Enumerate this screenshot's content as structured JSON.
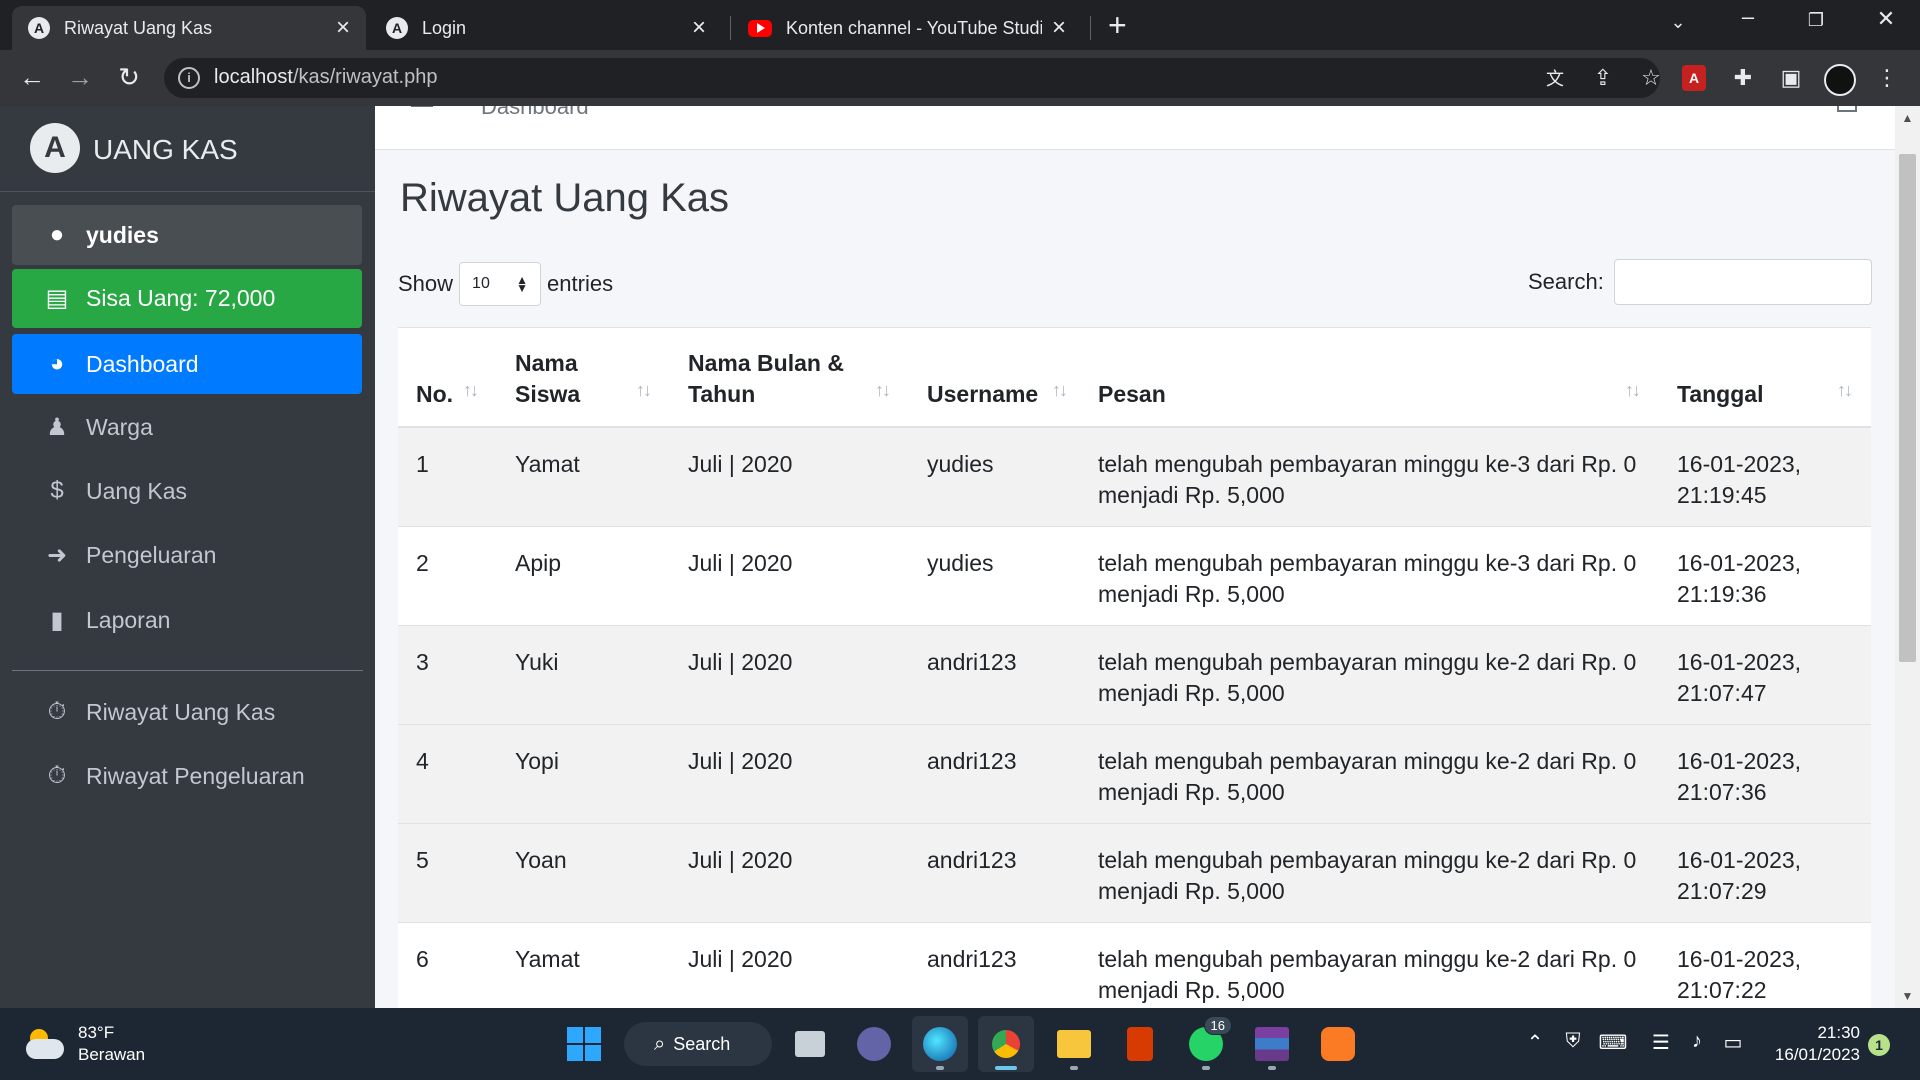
{
  "browser": {
    "tabs": [
      {
        "title": "Riwayat Uang Kas",
        "favicon": "uangkas-logo-icon",
        "active": true
      },
      {
        "title": "Login",
        "favicon": "uangkas-logo-icon",
        "active": false
      },
      {
        "title": "Konten channel - YouTube Studio",
        "favicon": "youtube-icon",
        "active": false
      }
    ],
    "url_host": "localhost",
    "url_path": "/kas/riwayat.php"
  },
  "sidebar": {
    "brand": "UANG KAS",
    "brand_logo_letter": "A",
    "user": "yudies",
    "balance": "Sisa Uang: 72,000",
    "items": [
      {
        "label": "Dashboard",
        "icon": "tachometer-icon"
      },
      {
        "label": "Warga",
        "icon": "user-icon"
      },
      {
        "label": "Uang Kas",
        "icon": "dollar-icon"
      },
      {
        "label": "Pengeluaran",
        "icon": "sign-out-icon"
      },
      {
        "label": "Laporan",
        "icon": "file-icon"
      },
      {
        "label": "Riwayat Uang Kas",
        "icon": "stopwatch-icon"
      },
      {
        "label": "Riwayat Pengeluaran",
        "icon": "stopwatch-icon"
      }
    ]
  },
  "topnav": {
    "breadcrumb": "Dashboard"
  },
  "main": {
    "title": "Riwayat Uang Kas",
    "show_label": "Show",
    "entries_value": "10",
    "entries_label": "entries",
    "search_label": "Search:",
    "search_value": ""
  },
  "table": {
    "columns": [
      "No.",
      "Nama Siswa",
      "Nama Bulan & Tahun",
      "Username",
      "Pesan",
      "Tanggal"
    ],
    "rows": [
      {
        "no": "1",
        "nama": "Yamat",
        "bulan": "Juli | 2020",
        "username": "yudies",
        "pesan": "telah mengubah pembayaran minggu ke-3 dari Rp. 0 menjadi Rp. 5,000",
        "tanggal": "16-01-2023, 21:19:45"
      },
      {
        "no": "2",
        "nama": "Apip",
        "bulan": "Juli | 2020",
        "username": "yudies",
        "pesan": "telah mengubah pembayaran minggu ke-3 dari Rp. 0 menjadi Rp. 5,000",
        "tanggal": "16-01-2023, 21:19:36"
      },
      {
        "no": "3",
        "nama": "Yuki",
        "bulan": "Juli | 2020",
        "username": "andri123",
        "pesan": "telah mengubah pembayaran minggu ke-2 dari Rp. 0 menjadi Rp. 5,000",
        "tanggal": "16-01-2023, 21:07:47"
      },
      {
        "no": "4",
        "nama": "Yopi",
        "bulan": "Juli | 2020",
        "username": "andri123",
        "pesan": "telah mengubah pembayaran minggu ke-2 dari Rp. 0 menjadi Rp. 5,000",
        "tanggal": "16-01-2023, 21:07:36"
      },
      {
        "no": "5",
        "nama": "Yoan",
        "bulan": "Juli | 2020",
        "username": "andri123",
        "pesan": "telah mengubah pembayaran minggu ke-2 dari Rp. 0 menjadi Rp. 5,000",
        "tanggal": "16-01-2023, 21:07:29"
      },
      {
        "no": "6",
        "nama": "Yamat",
        "bulan": "Juli | 2020",
        "username": "andri123",
        "pesan": "telah mengubah pembayaran minggu ke-2 dari Rp. 0 menjadi Rp. 5,000",
        "tanggal": "16-01-2023, 21:07:22"
      }
    ]
  },
  "taskbar": {
    "weather_temp": "83°F",
    "weather_desc": "Berawan",
    "search_label": "Search",
    "whatsapp_badge": "16",
    "time": "21:30",
    "date": "16/01/2023",
    "notification_count": "1"
  },
  "colors": {
    "sidebar_bg": "#343a40",
    "balance_green": "#28a745",
    "active_blue": "#007bff",
    "content_bg": "#f4f6f9"
  }
}
